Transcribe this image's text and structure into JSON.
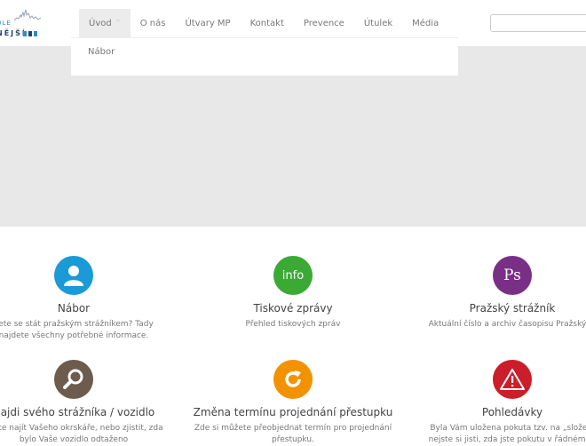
{
  "logo": {
    "top_text": "OLE",
    "bottom_text": "NĚJŠÍ"
  },
  "nav": {
    "items": [
      "Úvod",
      "O nás",
      "Útvary MP",
      "Kontakt",
      "Prevence",
      "Útulek",
      "Média"
    ],
    "active": "Úvod",
    "dropdown": [
      "Nábor"
    ]
  },
  "cards": [
    {
      "title": "Nábor",
      "desc_lines": [
        "cete se stát pražským strážníkem? Tady",
        "najdete všechny potřebné informace."
      ],
      "icon": "user-icon",
      "color": "#1a9ad6"
    },
    {
      "title": "Tiskové zprávy",
      "desc_lines": [
        "Přehled tiskových zpráv"
      ],
      "icon": "info-icon",
      "icon_text": "info",
      "color": "#3aaa35"
    },
    {
      "title": "Pražský strážník",
      "desc_lines": [
        "Aktuální číslo a archiv časopisu Pražský st"
      ],
      "icon": "ps-logo-icon",
      "icon_text": "Ps",
      "color": "#7a2f86"
    },
    {
      "title": "Najdi svého strážníka / vozidlo",
      "desc_lines": [
        "ůžete najít Vašeho okrskáře, nebo zjistit, zda",
        "bylo Vaše vozidlo odtaženo"
      ],
      "icon": "magnifier-icon",
      "color": "#6d5b4d"
    },
    {
      "title": "Změna termínu projednání přestupku",
      "desc_lines": [
        "Zde si můžete přeobjednat termín pro projednání",
        "přestupku."
      ],
      "icon": "refresh-icon",
      "color": "#f39200"
    },
    {
      "title": "Pohledávky",
      "desc_lines": [
        "Byla Vám uložena pokuta tzv. na „složení",
        "nejste si jisti, zda jste pokutu v řádném te"
      ],
      "icon": "warning-icon",
      "color": "#cc1d2a"
    }
  ]
}
